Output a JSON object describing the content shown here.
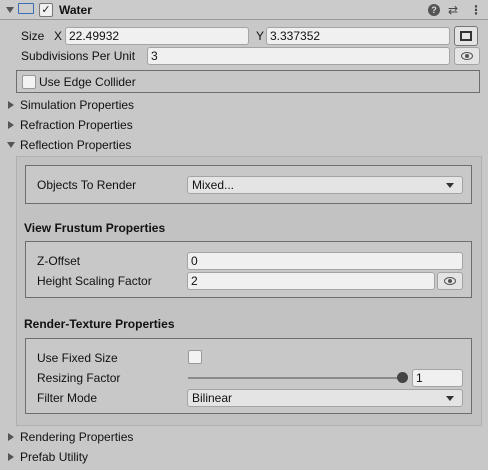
{
  "header": {
    "title": "Water",
    "component_enabled": true,
    "icons": [
      "foldout-arrow-icon",
      "component-icon",
      "help-icon",
      "presets-icon",
      "menu-icon"
    ]
  },
  "size": {
    "label": "Size",
    "x_label": "X",
    "x_value": "22.49932",
    "y_label": "Y",
    "y_value": "3.337352"
  },
  "subdivisions": {
    "label": "Subdivisions Per Unit",
    "value": "3"
  },
  "edge_collider": {
    "label": "Use Edge Collider",
    "checked": false
  },
  "sections": {
    "simulation": "Simulation Properties",
    "refraction": "Refraction Properties",
    "reflection": "Reflection Properties",
    "rendering": "Rendering Properties",
    "prefab": "Prefab Utility"
  },
  "reflection": {
    "objects_to_render": {
      "label": "Objects To Render",
      "value": "Mixed..."
    },
    "view_frustum": {
      "title": "View Frustum Properties",
      "z_offset": {
        "label": "Z-Offset",
        "value": "0"
      },
      "height_scaling": {
        "label": "Height Scaling Factor",
        "value": "2"
      }
    },
    "render_texture": {
      "title": "Render-Texture Properties",
      "use_fixed_size": {
        "label": "Use Fixed Size",
        "checked": false
      },
      "resizing_factor": {
        "label": "Resizing Factor",
        "value": "1",
        "slider_fraction": 1.0
      },
      "filter_mode": {
        "label": "Filter Mode",
        "value": "Bilinear"
      }
    }
  }
}
